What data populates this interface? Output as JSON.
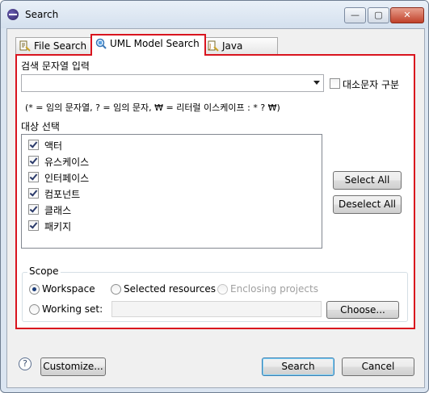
{
  "window": {
    "title": "Search",
    "minimize": "—",
    "maximize": "▢",
    "close": "✕"
  },
  "tabs": [
    {
      "label": "File Search"
    },
    {
      "label": "UML Model Search"
    },
    {
      "label": "Java Search"
    }
  ],
  "search": {
    "label": "검색 문자열 입력",
    "value": "",
    "case_label": "대소문자 구분",
    "hint": "(* = 임의 문자열, ? = 임의 문자, ₩ = 리터럴 이스케이프 : * ? ₩)"
  },
  "targets": {
    "label": "대상 선택",
    "items": [
      {
        "label": "액터",
        "checked": true
      },
      {
        "label": "유스케이스",
        "checked": true
      },
      {
        "label": "인터페이스",
        "checked": true
      },
      {
        "label": "컴포넌트",
        "checked": true
      },
      {
        "label": "클래스",
        "checked": true
      },
      {
        "label": "패키지",
        "checked": true
      }
    ],
    "select_all": "Select All",
    "deselect_all": "Deselect All"
  },
  "scope": {
    "label": "Scope",
    "workspace": "Workspace",
    "selected_resources": "Selected resources",
    "enclosing_projects": "Enclosing projects",
    "working_set": "Working set:",
    "working_set_value": "",
    "choose": "Choose...",
    "selected": "Workspace"
  },
  "footer": {
    "help": "?",
    "customize": "Customize...",
    "search": "Search",
    "cancel": "Cancel"
  }
}
